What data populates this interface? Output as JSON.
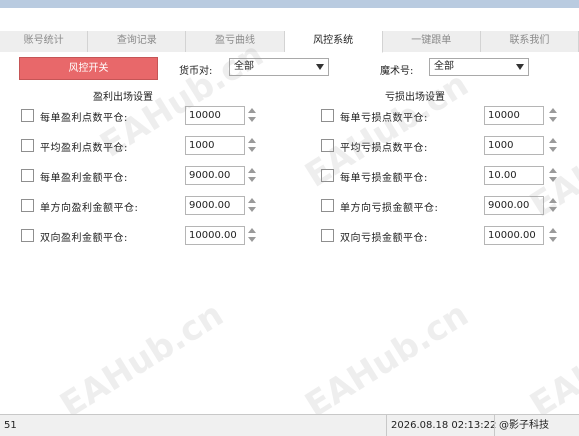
{
  "tabs": [
    {
      "label": "账号统计"
    },
    {
      "label": "查询记录"
    },
    {
      "label": "盈亏曲线"
    },
    {
      "label": "风控系统"
    },
    {
      "label": "一键跟单"
    },
    {
      "label": "联系我们"
    }
  ],
  "toolbar": {
    "toggle_label": "风控开关",
    "currency_label": "货币对:",
    "currency_value": "全部",
    "magic_label": "魔术号:",
    "magic_value": "全部"
  },
  "profit": {
    "title": "盈利出场设置",
    "rows": [
      {
        "label": "每单盈利点数平仓:",
        "value": "10000"
      },
      {
        "label": "平均盈利点数平仓:",
        "value": "1000"
      },
      {
        "label": "每单盈利金额平仓:",
        "value": "9000.00"
      },
      {
        "label": "单方向盈利金额平仓:",
        "value": "9000.00"
      },
      {
        "label": "双向盈利金额平仓:",
        "value": "10000.00"
      }
    ]
  },
  "loss": {
    "title": "亏损出场设置",
    "rows": [
      {
        "label": "每单亏损点数平仓:",
        "value": "10000"
      },
      {
        "label": "平均亏损点数平仓:",
        "value": "1000"
      },
      {
        "label": "每单亏损金额平仓:",
        "value": "10.00"
      },
      {
        "label": "单方向亏损金额平仓:",
        "value": "9000.00"
      },
      {
        "label": "双向亏损金额平仓:",
        "value": "10000.00"
      }
    ]
  },
  "status": {
    "left": "51",
    "datetime": "2026.08.18 02:13:22",
    "brand": "@影子科技"
  },
  "watermark": "EAHub.cn"
}
